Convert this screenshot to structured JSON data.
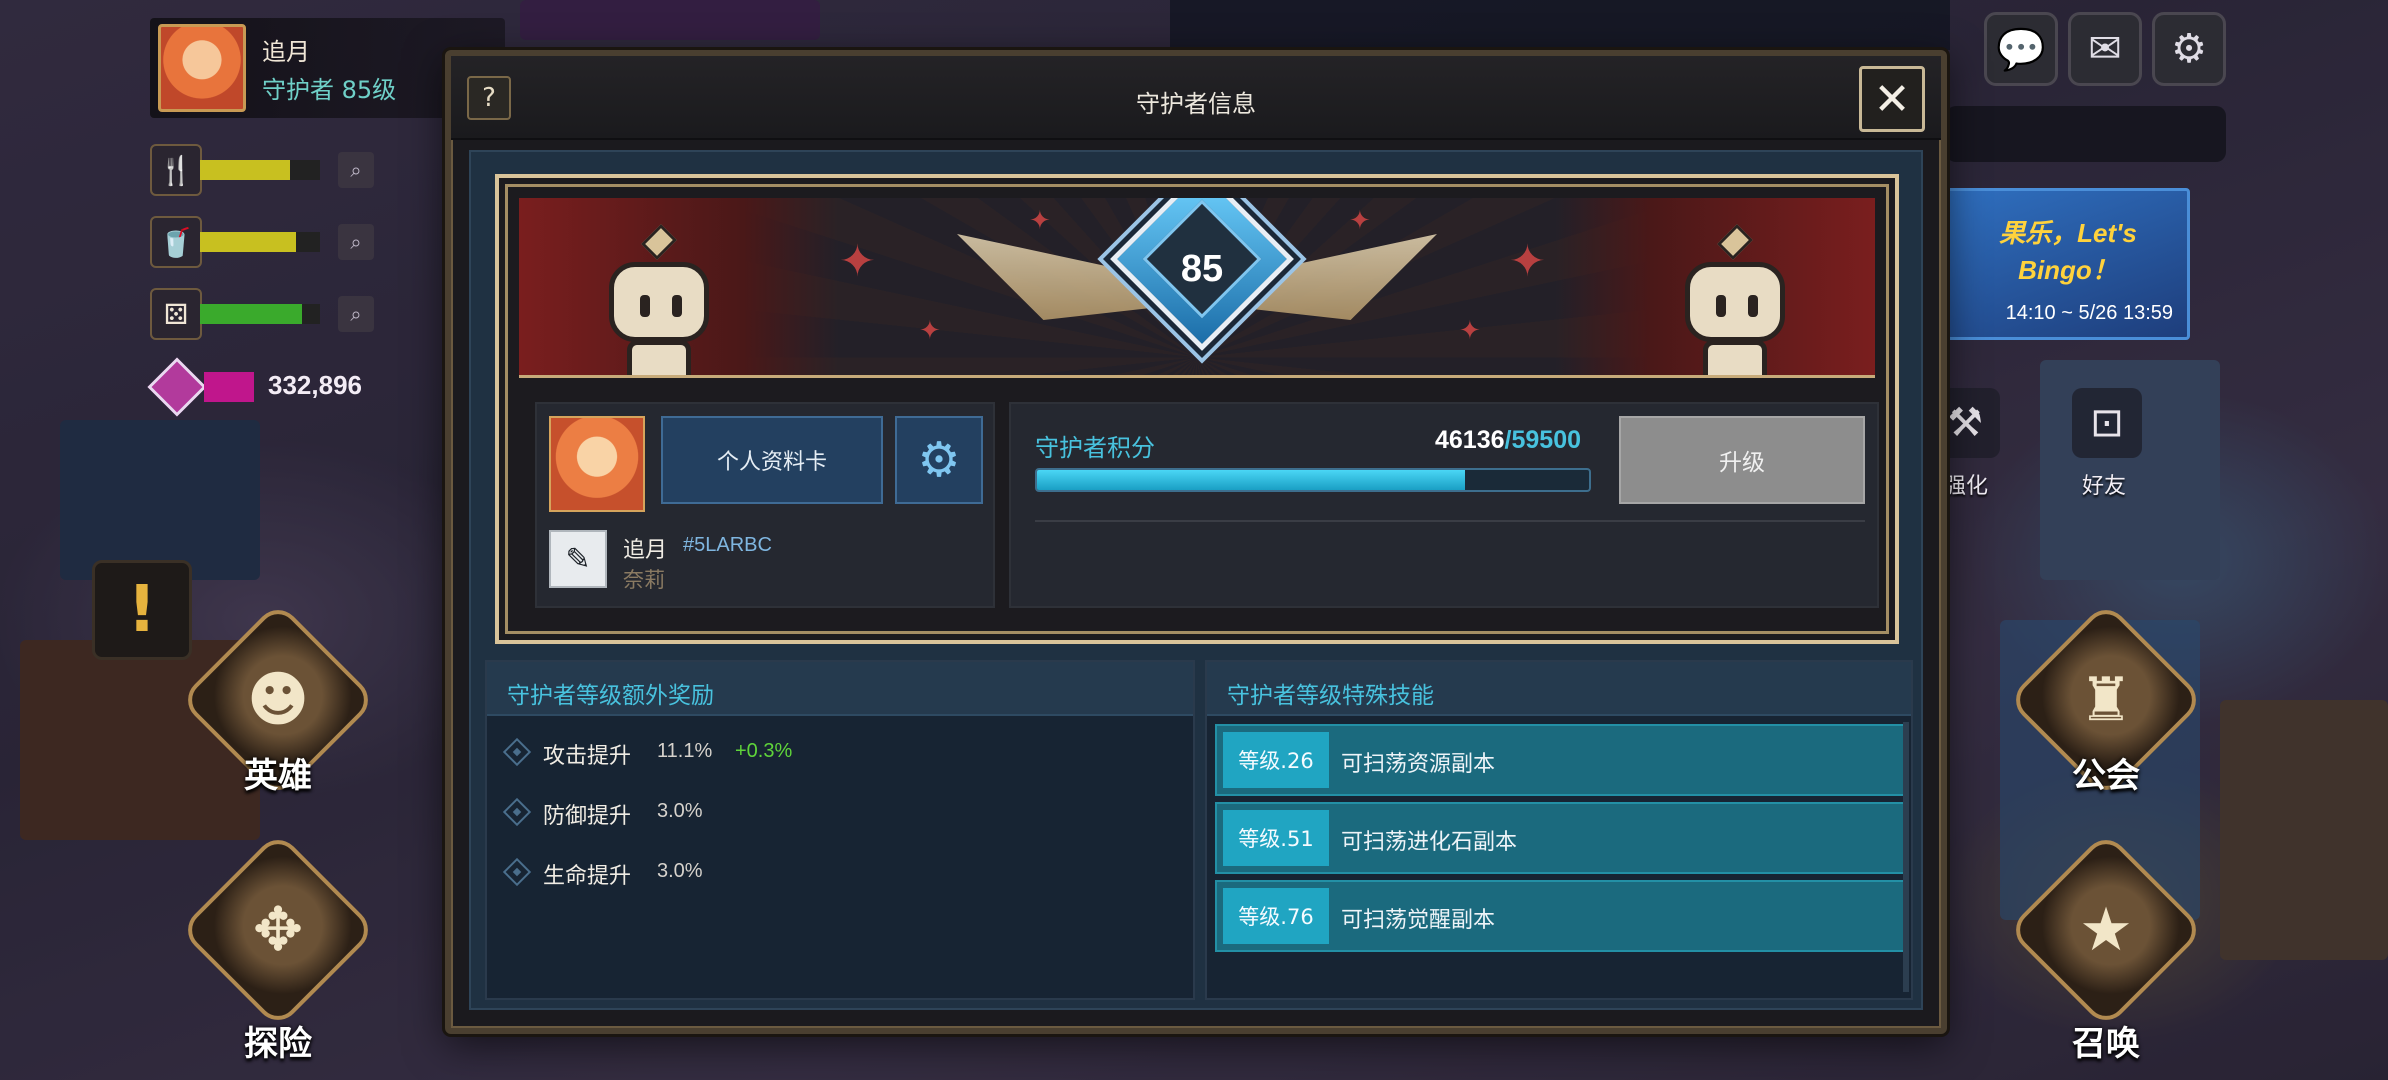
{
  "hud": {
    "player_name": "追月",
    "player_level": "守护者 85级",
    "gem_value": "332,896"
  },
  "resources": [
    {
      "icon": "fork-knife-icon",
      "fill_pct": 0.75,
      "color": "#c8c020"
    },
    {
      "icon": "cup-icon",
      "fill_pct": 0.8,
      "color": "#c8c020"
    },
    {
      "icon": "dice-icon",
      "fill_pct": 0.85,
      "color": "#3aaa2c"
    }
  ],
  "top_right": {
    "chat_icon": "chat-bubble-icon",
    "mail_icon": "mail-icon",
    "settings_icon": "gear-icon"
  },
  "banner": {
    "title": "果乐，Let's Bingo！",
    "date": "14:10 ~ 5/26 13:59"
  },
  "side_buttons": {
    "strengthen": "强化",
    "friends": "好友"
  },
  "nav": {
    "heroes": "英雄",
    "explore": "探险",
    "guild": "公会",
    "summon": "召唤"
  },
  "modal": {
    "title": "守护者信息",
    "help": "?",
    "close": "✕",
    "rank": "85",
    "profile": {
      "card_button": "个人资料卡",
      "name": "追月",
      "id": "#5LARBC",
      "sub_name": "奈莉"
    },
    "points": {
      "label": "守护者积分",
      "current": "46136",
      "max": "/59500",
      "progress": 0.775,
      "upgrade_button": "升级"
    },
    "bonus": {
      "title": "守护者等级额外奖励",
      "items": [
        {
          "name": "攻击提升",
          "value": "11.1%",
          "extra": "+0.3%"
        },
        {
          "name": "防御提升",
          "value": "3.0%",
          "extra": ""
        },
        {
          "name": "生命提升",
          "value": "3.0%",
          "extra": ""
        }
      ]
    },
    "skills": {
      "title": "守护者等级特殊技能",
      "items": [
        {
          "level": "等级.26",
          "desc": "可扫荡资源副本"
        },
        {
          "level": "等级.51",
          "desc": "可扫荡进化石副本"
        },
        {
          "level": "等级.76",
          "desc": "可扫荡觉醒副本"
        }
      ]
    }
  },
  "colors": {
    "accent_cyan": "#48c2de",
    "frame_gold": "#d9c49a",
    "bonus_green": "#5fd43a"
  }
}
